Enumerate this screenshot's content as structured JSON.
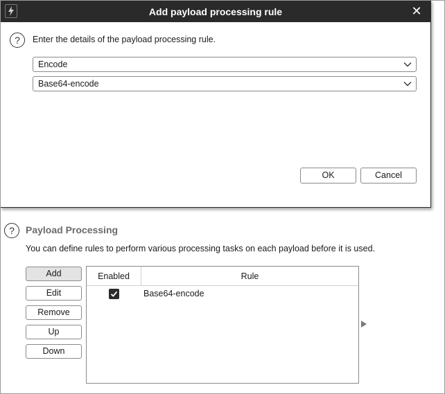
{
  "dialog": {
    "title": "Add payload processing rule",
    "prompt": "Enter the details of the payload processing rule.",
    "type_select": "Encode",
    "rule_select": "Base64-encode",
    "ok_label": "OK",
    "cancel_label": "Cancel"
  },
  "panel": {
    "title": "Payload Processing",
    "description": "You can define rules to perform various processing tasks on each payload before it is used.",
    "buttons": {
      "add": "Add",
      "edit": "Edit",
      "remove": "Remove",
      "up": "Up",
      "down": "Down"
    },
    "table": {
      "headers": [
        "Enabled",
        "Rule"
      ],
      "rows": [
        {
          "enabled": true,
          "rule": "Base64-encode"
        }
      ]
    }
  },
  "icons": {
    "app": "lightning-icon",
    "close": "close-icon",
    "help": "question-icon",
    "dropdown": "chevron-down-icon",
    "scroll": "triangle-right-icon"
  }
}
